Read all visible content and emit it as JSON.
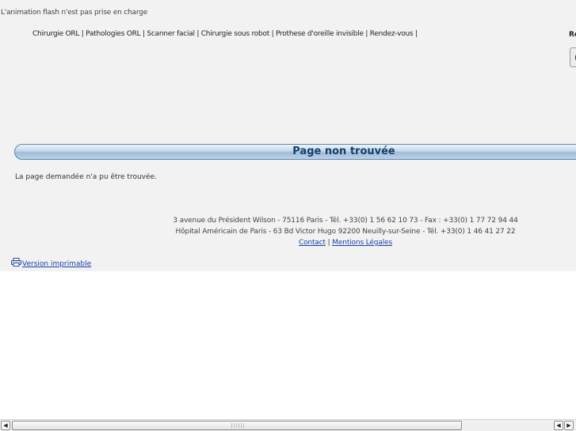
{
  "flash_notice": "L'animation flash n'est pas prise en charge",
  "nav": {
    "items": [
      {
        "label": "Chirurgie ORL |"
      },
      {
        "label": "Pathologies ORL |"
      },
      {
        "label": "Scanner facial |"
      },
      {
        "label": "Chirurgie sous robot |"
      },
      {
        "label": "Prothese d'oreille invisible |"
      },
      {
        "label": "Rendez-vous |"
      }
    ]
  },
  "right_label": "Re",
  "page_title": "Page non trouvée",
  "not_found_message": "La page demandée n'a pu être trouvée.",
  "footer": {
    "address_line1": "3 avenue du Président Wilson - 75116 Paris - Tél. +33(0) 1 56 62 10 73 - Fax : +33(0) 1 77 72 94 44",
    "address_line2": "Hôpital Américain de Paris - 63 Bd Victor Hugo 92200 Neuilly-sur-Seine - Tél. +33(0) 1 46 41 27 22",
    "contact_label": "Contact",
    "separator": "|",
    "legal_label": "Mentions Légales"
  },
  "print_label": "Version imprimable",
  "colors": {
    "title_text": "#133f69",
    "title_bar": "#9fbcda",
    "link": "#1a3fa8",
    "page_bg": "#f2f2f2"
  }
}
